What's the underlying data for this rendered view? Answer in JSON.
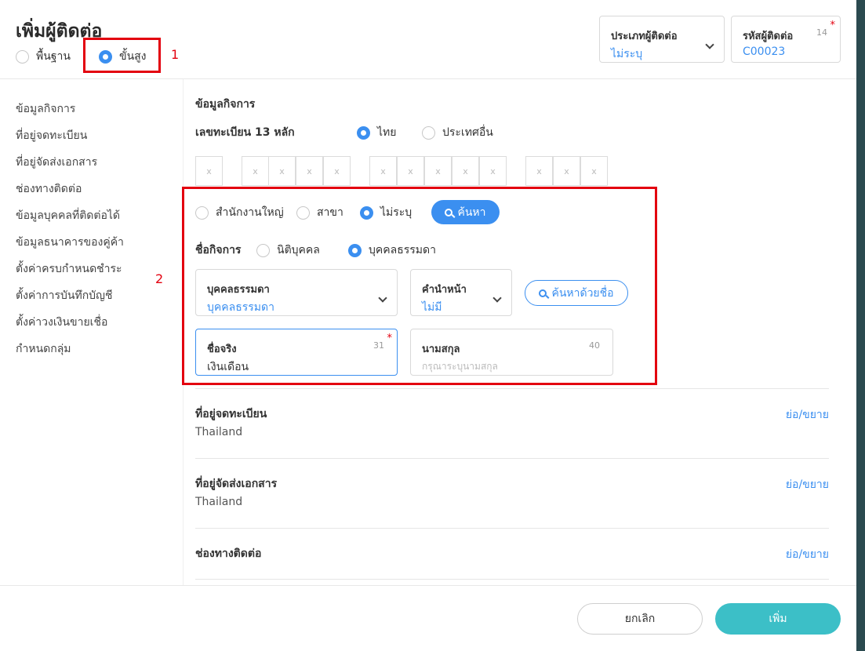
{
  "header": {
    "title": "เพิ่มผู้ติดต่อ",
    "mode_basic": "พื้นฐาน",
    "mode_advanced": "ขั้นสูง",
    "annotation_1": "1",
    "contact_type": {
      "label": "ประเภทผู้ติดต่อ",
      "value": "ไม่ระบุ"
    },
    "contact_code": {
      "label": "รหัสผู้ติดต่อ",
      "value": "C00023",
      "count": "14",
      "required": "*"
    }
  },
  "sidebar": {
    "annotation_2": "2",
    "items": [
      "ข้อมูลกิจการ",
      "ที่อยู่จดทะเบียน",
      "ที่อยู่จัดส่งเอกสาร",
      "ช่องทางติดต่อ",
      "ข้อมูลบุคคลที่ติดต่อได้",
      "ข้อมูลธนาคารของคู่ค้า",
      "ตั้งค่าครบกำหนดชำระ",
      "ตั้งค่าการบันทึกบัญชี",
      "ตั้งค่าวงเงินขายเชื่อ",
      "กำหนดกลุ่ม"
    ]
  },
  "business": {
    "section_title": "ข้อมูลกิจการ",
    "tax_id_label": "เลขทะเบียน 13 หลัก",
    "country_thai": "ไทย",
    "country_other": "ประเทศอื่น",
    "digit_placeholder": "x",
    "office_head": "สำนักงานใหญ่",
    "office_branch": "สาขา",
    "office_none": "ไม่ระบุ",
    "search_button": "ค้นหา",
    "name_label": "ชื่อกิจการ",
    "entity_juristic": "นิติบุคคล",
    "entity_person": "บุคคลธรรมดา",
    "person_type": {
      "label": "บุคคลธรรมดา",
      "value": "บุคคลธรรมดา"
    },
    "prefix": {
      "label": "คำนำหน้า",
      "value": "ไม่มี"
    },
    "search_by_name_button": "ค้นหาด้วยชื่อ",
    "first_name": {
      "label": "ชื่อจริง",
      "value": "เงินเดือน",
      "count": "31",
      "required": "*"
    },
    "last_name": {
      "label": "นามสกุล",
      "placeholder": "กรุณาระบุนามสกุล",
      "count": "40"
    }
  },
  "sections": [
    {
      "title": "ที่อยู่จดทะเบียน",
      "value": "Thailand",
      "toggle": "ย่อ/ขยาย"
    },
    {
      "title": "ที่อยู่จัดส่งเอกสาร",
      "value": "Thailand",
      "toggle": "ย่อ/ขยาย"
    },
    {
      "title": "ช่องทางติดต่อ",
      "toggle": "ย่อ/ขยาย"
    }
  ],
  "footer": {
    "cancel": "ยกเลิก",
    "add": "เพิ่ม"
  },
  "colors": {
    "accent": "#3b8ff0",
    "primary_button": "#3cbfc7",
    "annotation": "#e3000f"
  }
}
